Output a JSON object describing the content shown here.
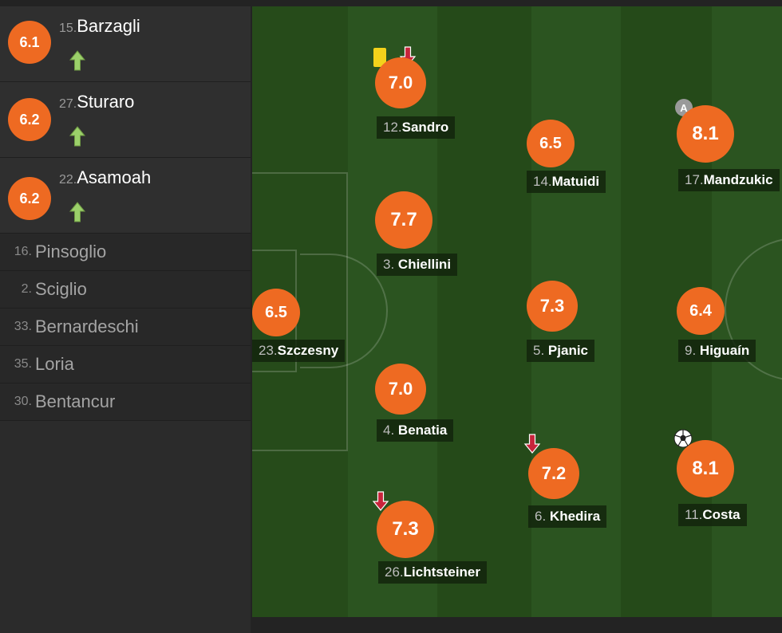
{
  "substitutes": [
    {
      "number": "15.",
      "name": "Barzagli",
      "rating": "6.1",
      "icon": "sub-in-arrow-icon"
    },
    {
      "number": "27.",
      "name": "Sturaro",
      "rating": "6.2",
      "icon": "sub-in-arrow-icon"
    },
    {
      "number": "22.",
      "name": "Asamoah",
      "rating": "6.2",
      "icon": "sub-in-arrow-icon"
    }
  ],
  "bench": [
    {
      "number": "16.",
      "name": "Pinsoglio"
    },
    {
      "number": "2.",
      "name": "Sciglio"
    },
    {
      "number": "33.",
      "name": "Bernardeschi"
    },
    {
      "number": "35.",
      "name": "Loria"
    },
    {
      "number": "30.",
      "name": "Bentancur"
    }
  ],
  "players": [
    {
      "key": "szczesny",
      "number": "23.",
      "name": "Szczesny",
      "rating": "6.5"
    },
    {
      "key": "sandro",
      "number": "12.",
      "name": "Sandro",
      "rating": "7.0",
      "icons": [
        "yellow-card-icon",
        "sub-out-arrow-icon"
      ]
    },
    {
      "key": "chiellini",
      "number": "3.",
      "name": "Chiellini",
      "rating": "7.7"
    },
    {
      "key": "benatia",
      "number": "4.",
      "name": "Benatia",
      "rating": "7.0"
    },
    {
      "key": "lichtsteiner",
      "number": "26.",
      "name": "Lichtsteiner",
      "rating": "7.3",
      "icons": [
        "sub-out-arrow-icon"
      ]
    },
    {
      "key": "matuidi",
      "number": "14.",
      "name": "Matuidi",
      "rating": "6.5"
    },
    {
      "key": "pjanic",
      "number": "5.",
      "name": "Pjanic",
      "rating": "7.3"
    },
    {
      "key": "khedira",
      "number": "6.",
      "name": "Khedira",
      "rating": "7.2",
      "icons": [
        "sub-out-arrow-icon"
      ]
    },
    {
      "key": "mandzukic",
      "number": "17.",
      "name": "Mandzukic",
      "rating": "8.1",
      "icons": [
        "captain-badge-icon"
      ],
      "captain_label": "A"
    },
    {
      "key": "higuain",
      "number": "9.",
      "name": "Higuaín",
      "rating": "6.4"
    },
    {
      "key": "costa",
      "number": "11.",
      "name": "Costa",
      "rating": "8.1",
      "icons": [
        "goal-ball-icon"
      ]
    }
  ],
  "colors": {
    "rating": "#ee6a22",
    "pitch_dark": "#254a19",
    "pitch_light": "#2d5720",
    "sub_in": "#9bd06a",
    "sub_out": "#c8243b",
    "yellow_card": "#f3d21b"
  }
}
